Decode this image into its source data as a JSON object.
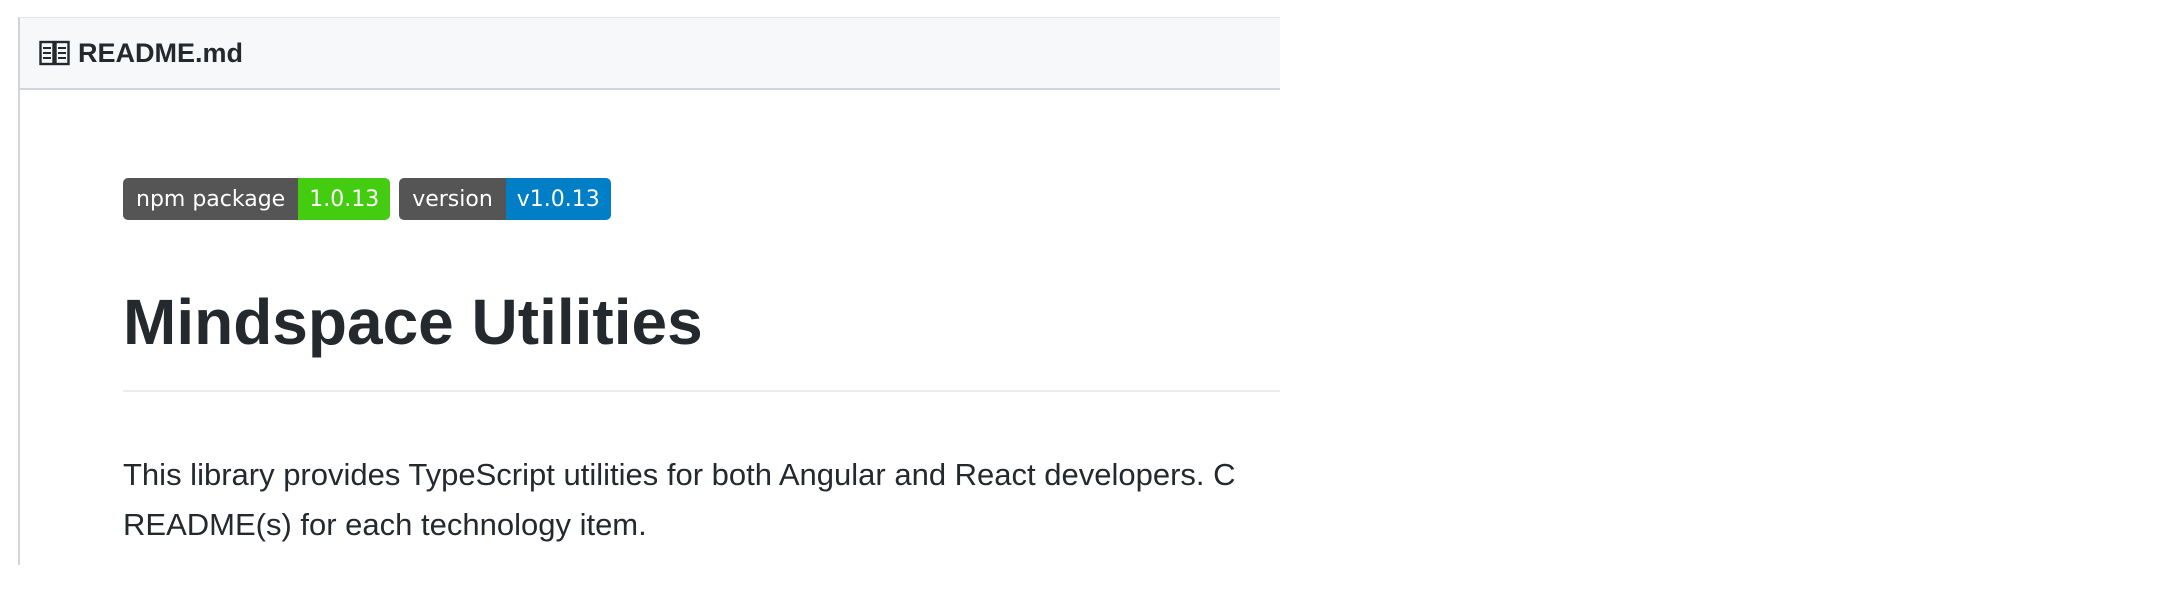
{
  "readme": {
    "filename": "README.md",
    "file_icon": "book-icon"
  },
  "badges": [
    {
      "label": "npm package",
      "value": "1.0.13",
      "color": "#4c1"
    },
    {
      "label": "version",
      "value": "v1.0.13",
      "color": "#007ec6"
    }
  ],
  "content": {
    "title": "Mindspace Utilities",
    "description_line1": "This library provides TypeScript utilities for both Angular and React developers. C",
    "description_line2": "README(s) for each technology item."
  }
}
